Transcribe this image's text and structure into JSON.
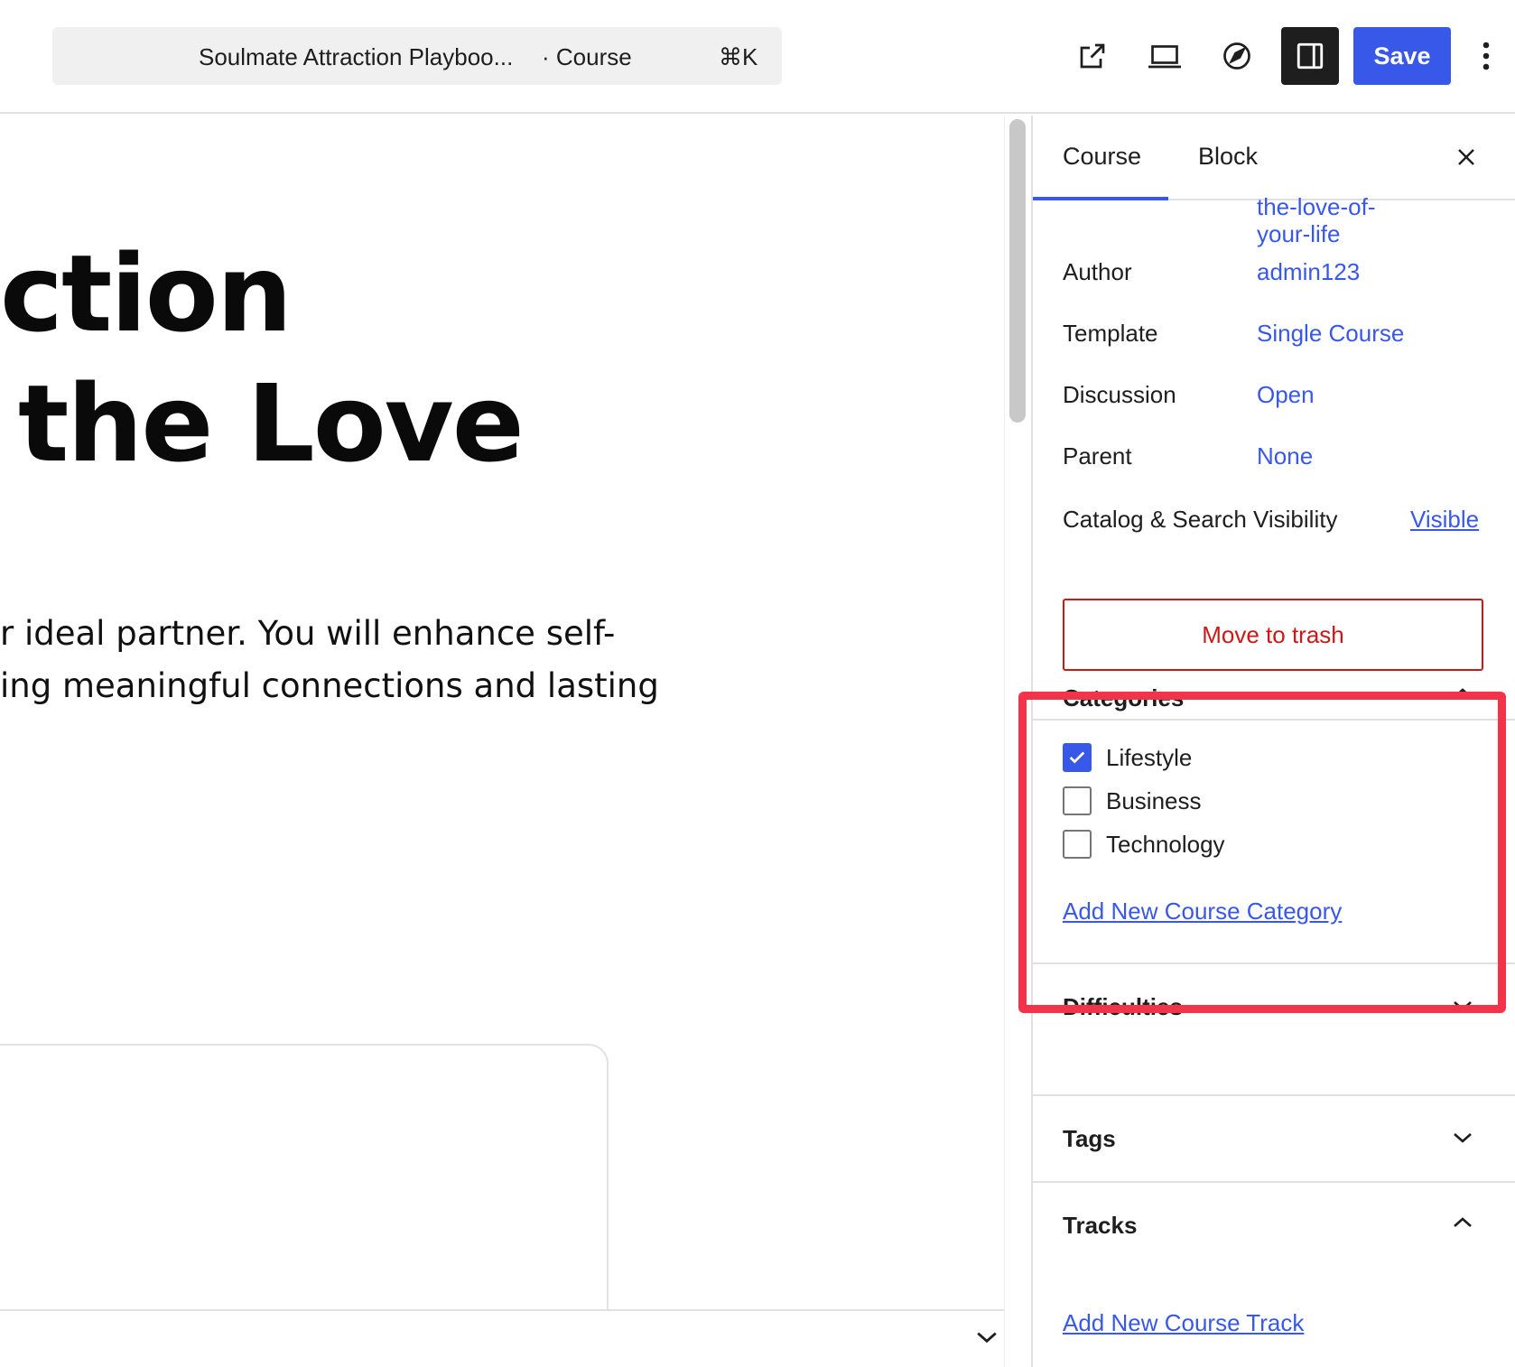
{
  "topbar": {
    "doc_title": "Soulmate Attraction Playboo...",
    "doc_type": "· Course",
    "shortcut": "⌘K",
    "icons": [
      "external-link-icon",
      "desktop-preview-icon",
      "rocket-icon",
      "sidebar-panel-icon",
      "more-vertical-icon"
    ],
    "save_label": "Save",
    "accent_color": "#3858e9"
  },
  "canvas": {
    "heading_line1": "ction",
    "heading_line2": "the Love",
    "body_line1": "r ideal partner. You will enhance self-",
    "body_line2": "ing meaningful connections and lasting"
  },
  "sidebar": {
    "tabs": [
      {
        "label": "Course",
        "active": true
      },
      {
        "label": "Block",
        "active": false
      }
    ],
    "slug_line1": "the-love-of-",
    "slug_line2": "your-life",
    "rows": [
      {
        "label": "Author",
        "value": "admin123"
      },
      {
        "label": "Template",
        "value": "Single Course"
      },
      {
        "label": "Discussion",
        "value": "Open"
      },
      {
        "label": "Parent",
        "value": "None"
      },
      {
        "label": "Catalog & Search Visibility",
        "value": "Visible"
      }
    ],
    "trash_label": "Move to trash",
    "trash_color": "#cc1818",
    "categories": {
      "title": "Categories",
      "expanded": true,
      "items": [
        {
          "label": "Lifestyle",
          "checked": true
        },
        {
          "label": "Business",
          "checked": false
        },
        {
          "label": "Technology",
          "checked": false
        }
      ],
      "add_link": "Add New Course Category"
    },
    "difficulties": {
      "title": "Difficulties",
      "expanded": false
    },
    "tags": {
      "title": "Tags",
      "expanded": false
    },
    "tracks": {
      "title": "Tracks",
      "expanded": true,
      "add_link": "Add New Course Track"
    },
    "highlight_color": "#f2334a"
  }
}
